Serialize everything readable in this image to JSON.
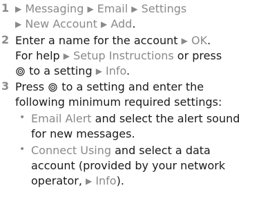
{
  "steps": [
    {
      "num": "1",
      "lines": [
        {
          "parts": [
            {
              "t": "arrow"
            },
            {
              "t": "gray",
              "v": "Messaging"
            },
            {
              "t": "arrow"
            },
            {
              "t": "gray",
              "v": "Email"
            },
            {
              "t": "arrow"
            },
            {
              "t": "gray",
              "v": "Settings"
            }
          ]
        },
        {
          "parts": [
            {
              "t": "arrow"
            },
            {
              "t": "gray",
              "v": "New Account"
            },
            {
              "t": "arrow"
            },
            {
              "t": "gray",
              "v": "Add"
            },
            {
              "t": "text",
              "v": "."
            }
          ]
        }
      ]
    },
    {
      "num": "2",
      "lines": [
        {
          "parts": [
            {
              "t": "text",
              "v": "Enter a name for the account "
            },
            {
              "t": "arrow"
            },
            {
              "t": "gray",
              "v": "OK"
            },
            {
              "t": "text",
              "v": "."
            }
          ]
        },
        {
          "parts": [
            {
              "t": "text",
              "v": "For help "
            },
            {
              "t": "arrow"
            },
            {
              "t": "gray",
              "v": "Setup Instructions"
            },
            {
              "t": "text",
              "v": " or press"
            }
          ]
        },
        {
          "parts": [
            {
              "t": "nav"
            },
            {
              "t": "text",
              "v": " to a setting "
            },
            {
              "t": "arrow"
            },
            {
              "t": "gray",
              "v": "Info"
            },
            {
              "t": "text",
              "v": "."
            }
          ]
        }
      ]
    },
    {
      "num": "3",
      "lines": [
        {
          "parts": [
            {
              "t": "text",
              "v": "Press "
            },
            {
              "t": "nav"
            },
            {
              "t": "text",
              "v": " to a setting and enter the"
            }
          ]
        },
        {
          "parts": [
            {
              "t": "text",
              "v": "following minimum required settings:"
            }
          ]
        }
      ]
    }
  ],
  "bullets": [
    {
      "lines": [
        {
          "parts": [
            {
              "t": "gray",
              "v": "Email Alert"
            },
            {
              "t": "text",
              "v": " and select the alert sound"
            }
          ]
        },
        {
          "parts": [
            {
              "t": "text",
              "v": "for new messages."
            }
          ]
        }
      ]
    },
    {
      "lines": [
        {
          "parts": [
            {
              "t": "gray",
              "v": "Connect Using"
            },
            {
              "t": "text",
              "v": " and select a data"
            }
          ]
        },
        {
          "parts": [
            {
              "t": "text",
              "v": "account (provided by your network"
            }
          ]
        },
        {
          "parts": [
            {
              "t": "text",
              "v": "operator, "
            },
            {
              "t": "arrow"
            },
            {
              "t": "gray",
              "v": "Info"
            },
            {
              "t": "text",
              "v": ")."
            }
          ]
        }
      ]
    }
  ],
  "colors": {
    "accent_gray": "#8a8a8a",
    "text": "#1a1a1a"
  },
  "icons": {
    "arrow": "play-arrow-icon",
    "nav": "navigation-key-icon"
  }
}
